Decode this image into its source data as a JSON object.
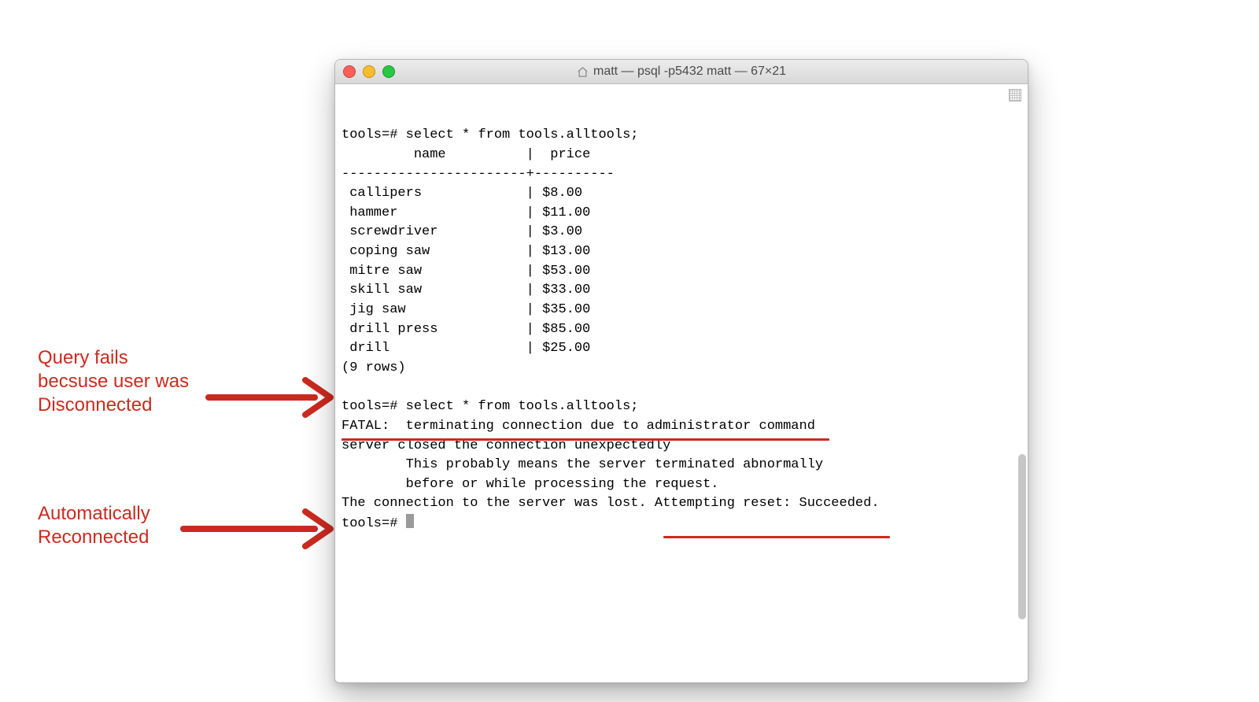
{
  "colors": {
    "annotation_red": "#cc2a1f"
  },
  "annotations": {
    "query_fail": "Query fails\nbecsuse user was\nDisconnected",
    "auto_reconnect": "Automatically\nReconnected"
  },
  "window": {
    "title": "matt — psql -p5432 matt — 67×21"
  },
  "terminal": {
    "prompt": "tools=#",
    "query": "select * from tools.alltools;",
    "columns": {
      "name_header": "name",
      "price_header": "price"
    },
    "rows": [
      {
        "name": "callipers",
        "price": "$8.00"
      },
      {
        "name": "hammer",
        "price": "$11.00"
      },
      {
        "name": "screwdriver",
        "price": "$3.00"
      },
      {
        "name": "coping saw",
        "price": "$13.00"
      },
      {
        "name": "mitre saw",
        "price": "$53.00"
      },
      {
        "name": "skill saw",
        "price": "$33.00"
      },
      {
        "name": "jig saw",
        "price": "$35.00"
      },
      {
        "name": "drill press",
        "price": "$85.00"
      },
      {
        "name": "drill",
        "price": "$25.00"
      }
    ],
    "row_count_line": "(9 rows)",
    "fatal_line": "FATAL:  terminating connection due to administrator command",
    "closed_line": "server closed the connection unexpectedly",
    "explain_line1": "        This probably means the server terminated abnormally",
    "explain_line2": "        before or while processing the request.",
    "reset_prefix": "The connection to the server was lost. ",
    "reset_highlight": "Attempting reset: Succeeded."
  }
}
